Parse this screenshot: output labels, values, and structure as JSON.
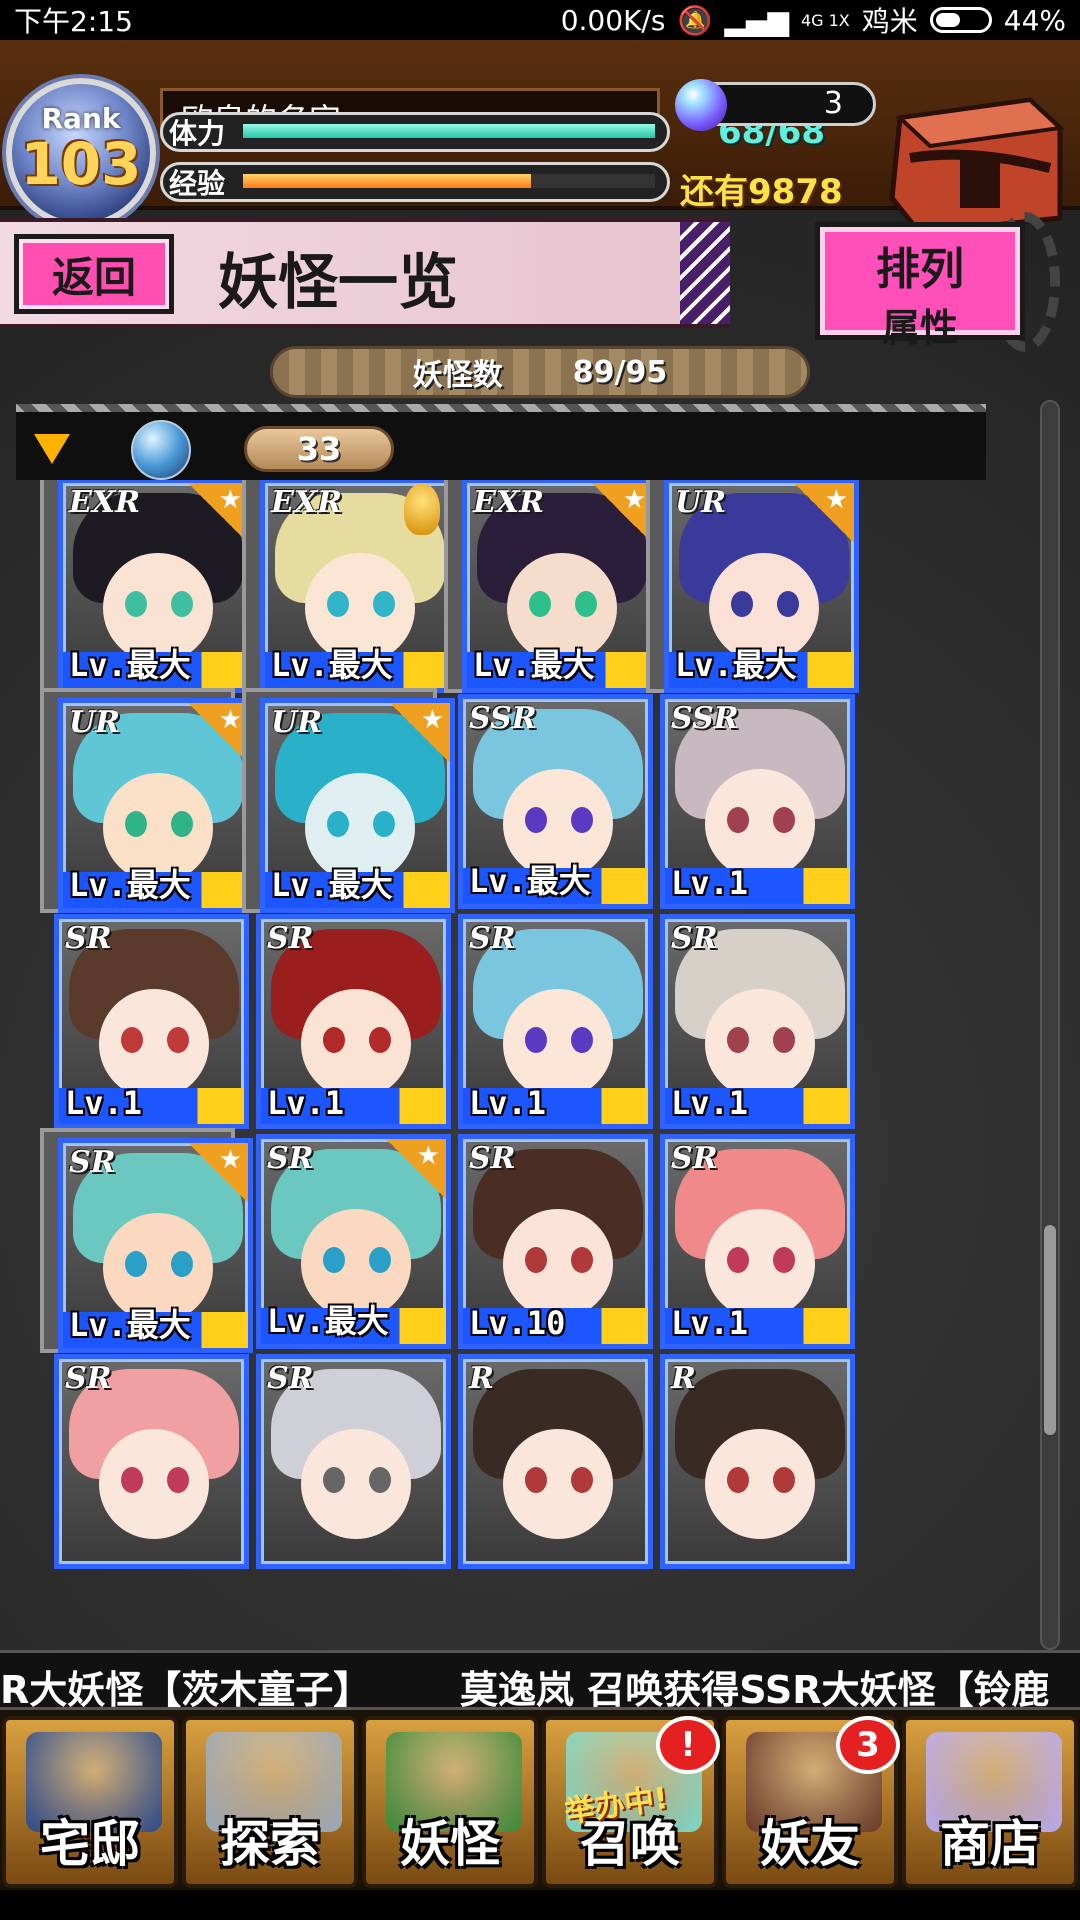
{
  "status_bar": {
    "time": "下午2:15",
    "network_speed": "0.00K/s",
    "network_type": "4G 1X",
    "carrier": "鸡米",
    "battery": "44%",
    "battery_level": 0.44
  },
  "header": {
    "rank_label": "Rank",
    "rank_value": "103",
    "player_name": "欧皇的名字",
    "stamina_label": "体力",
    "stamina_value": "68/68",
    "stamina_fraction": 1.0,
    "exp_label": "经验",
    "exp_remaining": "还有9878",
    "exp_fraction": 0.7,
    "orb_count": "3"
  },
  "title_bar": {
    "back_label": "返回",
    "title": "妖怪一览",
    "sort_line1": "排列",
    "sort_line2": "属性"
  },
  "count_bar": {
    "label": "妖怪数",
    "value": "89/95"
  },
  "filter_bar": {
    "cost_value": "33"
  },
  "cards": [
    {
      "rarity": "EXR",
      "level": "Lv.最大",
      "star": true,
      "selected": true,
      "hair": "#1e1a24",
      "skin": "#fbe3d4",
      "eyes": "#3fbfa0"
    },
    {
      "rarity": "EXR",
      "level": "Lv.最大",
      "star": false,
      "medal": true,
      "selected": true,
      "hair": "#e6dca0",
      "skin": "#fbe6d6",
      "eyes": "#2fb4c8"
    },
    {
      "rarity": "EXR",
      "level": "Lv.最大",
      "star": true,
      "selected": true,
      "hair": "#2a1e3a",
      "skin": "#f6dccb",
      "eyes": "#2fbf8a"
    },
    {
      "rarity": "UR",
      "level": "Lv.最大",
      "star": true,
      "selected": true,
      "hair": "#3a3a9a",
      "skin": "#fbe0d6",
      "eyes": "#3a3a9a"
    },
    {
      "rarity": "UR",
      "level": "Lv.最大",
      "star": true,
      "selected": true,
      "hair": "#5fc6d6",
      "skin": "#fbe0c8",
      "eyes": "#2fb48a"
    },
    {
      "rarity": "UR",
      "level": "Lv.最大",
      "star": true,
      "selected": true,
      "hair": "#2ab0c8",
      "skin": "#dfeef0",
      "eyes": "#2ab0c8"
    },
    {
      "rarity": "SSR",
      "level": "Lv.最大",
      "star": false,
      "selected": false,
      "hair": "#7ac6de",
      "skin": "#fbe6d8",
      "eyes": "#5a3ac0"
    },
    {
      "rarity": "SSR",
      "level": "Lv.1",
      "star": false,
      "selected": false,
      "hair": "#c8b8c0",
      "skin": "#fbe6dc",
      "eyes": "#a04050"
    },
    {
      "rarity": "SR",
      "level": "Lv.1",
      "star": false,
      "selected": false,
      "hair": "#5a3a2a",
      "skin": "#fbe6dc",
      "eyes": "#c03a3a"
    },
    {
      "rarity": "SR",
      "level": "Lv.1",
      "star": false,
      "selected": false,
      "hair": "#9a1e1e",
      "skin": "#fbe3d4",
      "eyes": "#b02a2a"
    },
    {
      "rarity": "SR",
      "level": "Lv.1",
      "star": false,
      "selected": false,
      "hair": "#7ac6de",
      "skin": "#fbe6d8",
      "eyes": "#5a3ac0"
    },
    {
      "rarity": "SR",
      "level": "Lv.1",
      "star": false,
      "selected": false,
      "hair": "#d6d0c8",
      "skin": "#fbe6dc",
      "eyes": "#a04050"
    },
    {
      "rarity": "SR",
      "level": "Lv.最大",
      "star": true,
      "selected": true,
      "hair": "#6ac8c0",
      "skin": "#fbd8c0",
      "eyes": "#2aa0c8"
    },
    {
      "rarity": "SR",
      "level": "Lv.最大",
      "star": true,
      "selected": false,
      "hair": "#6ac8c0",
      "skin": "#fbd8c0",
      "eyes": "#2aa0c8"
    },
    {
      "rarity": "SR",
      "level": "Lv.10",
      "star": false,
      "selected": false,
      "hair": "#4a2e24",
      "skin": "#fbe3d8",
      "eyes": "#b03a3a"
    },
    {
      "rarity": "SR",
      "level": "Lv.1",
      "star": false,
      "selected": false,
      "hair": "#f08a8a",
      "skin": "#fbe6dc",
      "eyes": "#c03a5a"
    },
    {
      "rarity": "SR",
      "level": "",
      "star": false,
      "selected": false,
      "hair": "#f0a0a0",
      "skin": "#fbe6dc",
      "eyes": "#c03a5a"
    },
    {
      "rarity": "SR",
      "level": "",
      "star": false,
      "selected": false,
      "hair": "#cfcfd8",
      "skin": "#fbe6dc",
      "eyes": "#666"
    },
    {
      "rarity": "R",
      "level": "",
      "star": false,
      "selected": false,
      "hair": "#3a2a24",
      "skin": "#fbe6dc",
      "eyes": "#b03a3a"
    },
    {
      "rarity": "R",
      "level": "",
      "star": false,
      "selected": false,
      "hair": "#3a2a24",
      "skin": "#fbe6dc",
      "eyes": "#b03a3a"
    }
  ],
  "ticker": {
    "text_left": "R大妖怪【茨木童子】",
    "text_right": "莫逸岚 召唤获得SSR大妖怪【铃鹿"
  },
  "bottom_nav": [
    {
      "label": "宅邸",
      "icon": "house-icon",
      "color": "#2b4a8a"
    },
    {
      "label": "探索",
      "icon": "magnifier-icon",
      "color": "#9aa8b8"
    },
    {
      "label": "妖怪",
      "icon": "scroll-icon",
      "color": "#3a8a3a"
    },
    {
      "label": "召唤",
      "icon": "star-icon",
      "color": "#7ad8c8",
      "badge": "!",
      "holding": "举办中!"
    },
    {
      "label": "妖友",
      "icon": "friend-icon",
      "color": "#6a3a2a",
      "badge": "3"
    },
    {
      "label": "商店",
      "icon": "orb-icon",
      "color": "#b8a8f0"
    }
  ]
}
